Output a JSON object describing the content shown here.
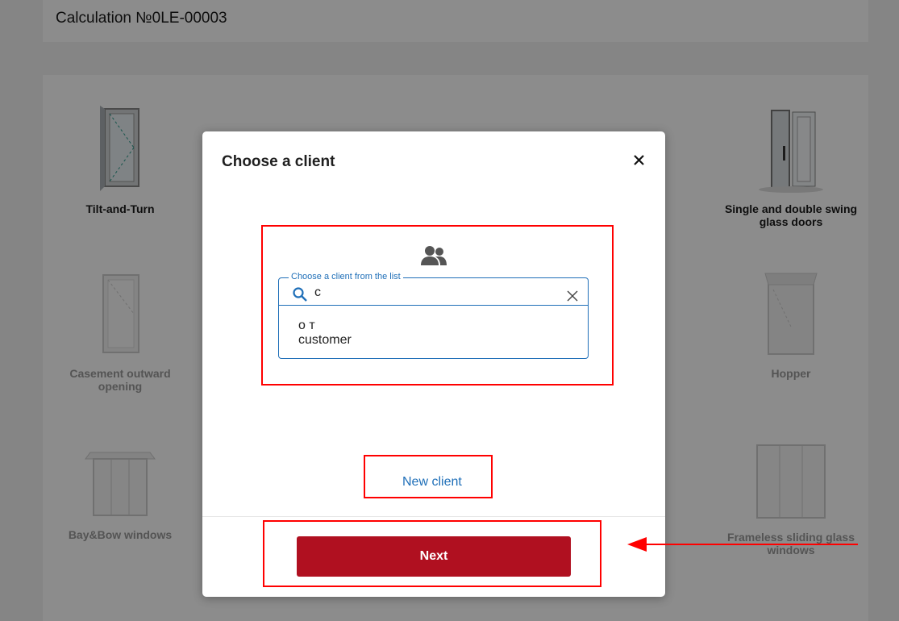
{
  "page": {
    "title": "Calculation №0LE-00003"
  },
  "products": [
    {
      "label": "Tilt-and-Turn"
    },
    {
      "label": "Single and double swing glass doors"
    },
    {
      "label": "Casement outward opening"
    },
    {
      "label": "Hopper"
    },
    {
      "label": "Bay&Bow windows"
    },
    {
      "label": "Frameless sliding glass windows"
    }
  ],
  "modal": {
    "title": "Choose a client",
    "field_legend": "Choose a client from the list",
    "search_value": "c",
    "option_line1": "о т",
    "option_line2": "customer",
    "new_client_label": "New client",
    "next_label": "Next"
  },
  "icons": [
    "close-icon",
    "users-icon",
    "search-icon",
    "clear-icon"
  ],
  "colors": {
    "accent_blue": "#1f6fb8",
    "next_button": "#b01020",
    "annotation": "#ff0000"
  }
}
